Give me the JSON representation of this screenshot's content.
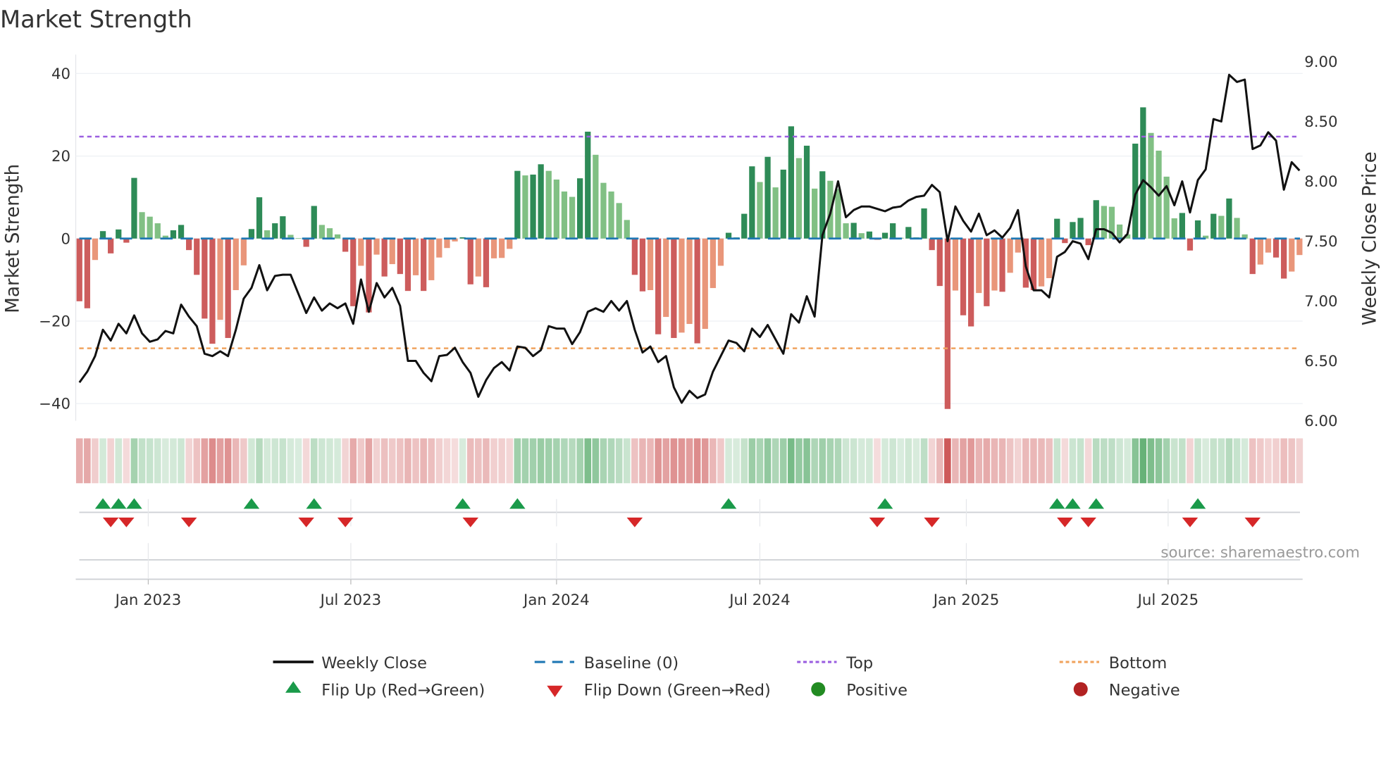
{
  "chart_data": {
    "type": "bar",
    "title": "Market Strength",
    "ylabel": "Market Strength",
    "y2label": "Weekly Close Price",
    "ylim": [
      -44,
      43
    ],
    "y2lim": [
      6.0,
      9.0
    ],
    "yticks": [
      "40",
      "20",
      "0",
      "−20",
      "−40"
    ],
    "ytick_values": [
      40,
      20,
      0,
      -20,
      -40
    ],
    "y2ticks": [
      "9.00",
      "8.50",
      "8.00",
      "7.50",
      "7.00",
      "6.50",
      "6.00"
    ],
    "y2tick_values": [
      9.0,
      8.5,
      8.0,
      7.5,
      7.0,
      6.5,
      6.0
    ],
    "xticks": [
      "Jan 2023",
      "Jul 2023",
      "Jan 2024",
      "Jul 2024",
      "Jan 2025",
      "Jul 2025"
    ],
    "xtick_week_index": [
      8.8,
      34.7,
      61,
      87,
      113.4,
      139.2
    ],
    "grid": true,
    "top_level": 24.7,
    "bottom_level": -26.6,
    "baseline": 0,
    "strength": [
      -15.2,
      -16.9,
      -5.2,
      1.8,
      -3.6,
      2.2,
      -1.0,
      14.7,
      6.4,
      5.3,
      3.7,
      0.7,
      2.0,
      3.3,
      -2.8,
      -8.8,
      -19.4,
      -25.5,
      -19.7,
      -24.1,
      -12.5,
      -6.5,
      2.3,
      10.0,
      2.0,
      3.7,
      5.4,
      0.9,
      0.1,
      -2.0,
      7.9,
      3.3,
      2.5,
      1.0,
      -3.2,
      -16.4,
      -6.6,
      -17.9,
      -3.9,
      -9.2,
      -6.2,
      -8.6,
      -12.7,
      -8.9,
      -12.7,
      -10.1,
      -4.6,
      -2.3,
      -0.7,
      0.3,
      -11.1,
      -9.2,
      -11.8,
      -4.8,
      -4.7,
      -2.5,
      16.4,
      15.3,
      15.5,
      18.0,
      16.4,
      14.3,
      11.4,
      10.1,
      14.6,
      25.9,
      20.3,
      13.5,
      11.4,
      8.6,
      4.5,
      -8.8,
      -12.8,
      -12.5,
      -23.2,
      -19.0,
      -24.1,
      -22.8,
      -20.7,
      -25.4,
      -21.9,
      -12.0,
      -6.6,
      1.4,
      0.3,
      6.0,
      17.5,
      13.7,
      19.8,
      12.4,
      16.7,
      27.2,
      19.5,
      22.5,
      12.1,
      16.3,
      14.0,
      12.0,
      3.7,
      3.8,
      1.3,
      1.7,
      -0.3,
      1.4,
      3.7,
      0.2,
      2.8,
      0.3,
      7.3,
      -2.8,
      -11.5,
      -41.3,
      -12.6,
      -18.6,
      -21.3,
      -13.2,
      -16.4,
      -12.6,
      -12.9,
      -8.3,
      -3.4,
      -11.9,
      -12.5,
      -11.6,
      -9.6,
      4.8,
      -1.1,
      4.0,
      5.0,
      -1.6,
      9.3,
      7.9,
      7.7,
      3.4,
      1.0,
      23.0,
      31.8,
      25.6,
      21.3,
      15.0,
      4.9,
      6.2,
      -2.9,
      4.4,
      0.7,
      6.0,
      5.5,
      9.7,
      5.0,
      1.0,
      -8.6,
      -6.3,
      -3.4,
      -4.6,
      -9.7,
      -8.0,
      -4.0
    ],
    "weekly_close": [
      6.32,
      6.41,
      6.54,
      6.76,
      6.67,
      6.81,
      6.73,
      6.88,
      6.73,
      6.66,
      6.68,
      6.75,
      6.73,
      6.97,
      6.87,
      6.79,
      6.56,
      6.54,
      6.58,
      6.54,
      6.76,
      7.02,
      7.11,
      7.3,
      7.09,
      7.21,
      7.22,
      7.22,
      7.06,
      6.9,
      7.03,
      6.92,
      6.98,
      6.94,
      6.98,
      6.81,
      7.18,
      6.91,
      7.15,
      7.03,
      7.11,
      6.96,
      6.5,
      6.5,
      6.4,
      6.33,
      6.54,
      6.55,
      6.61,
      6.49,
      6.4,
      6.2,
      6.34,
      6.44,
      6.49,
      6.42,
      6.62,
      6.61,
      6.54,
      6.59,
      6.79,
      6.77,
      6.77,
      6.64,
      6.74,
      6.91,
      6.94,
      6.91,
      7.0,
      6.92,
      7.0,
      6.76,
      6.57,
      6.62,
      6.49,
      6.54,
      6.28,
      6.15,
      6.25,
      6.19,
      6.22,
      6.41,
      6.54,
      6.67,
      6.65,
      6.58,
      6.77,
      6.7,
      6.8,
      6.68,
      6.56,
      6.89,
      6.82,
      7.04,
      6.87,
      7.55,
      7.73,
      8.0,
      7.7,
      7.76,
      7.79,
      7.79,
      7.77,
      7.75,
      7.78,
      7.79,
      7.84,
      7.87,
      7.88,
      7.97,
      7.91,
      7.5,
      7.79,
      7.67,
      7.58,
      7.73,
      7.55,
      7.59,
      7.53,
      7.61,
      7.76,
      7.29,
      7.09,
      7.09,
      7.03,
      7.37,
      7.41,
      7.5,
      7.48,
      7.35,
      7.6,
      7.6,
      7.57,
      7.49,
      7.56,
      7.89,
      8.01,
      7.95,
      7.88,
      7.96,
      7.8,
      8.0,
      7.74,
      8.01,
      8.1,
      8.52,
      8.5,
      8.89,
      8.83,
      8.85,
      8.27,
      8.3,
      8.41,
      8.34,
      7.93,
      8.16,
      8.09
    ],
    "legend": {
      "placement": "bottom",
      "weekly_close": "Weekly Close",
      "baseline": "Baseline (0)",
      "top": "Top",
      "bottom": "Bottom",
      "flip_up": "Flip Up (Red→Green)",
      "flip_down": "Flip Down (Green→Red)",
      "positive": "Positive",
      "negative": "Negative"
    },
    "source": "source: sharemaestro.com",
    "colors": {
      "pos_strong": "#2e8b57",
      "pos_weak": "#81c084",
      "neg_strong": "#cd5c5c",
      "neg_weak": "#e9967a",
      "baseline": "#1f77b4",
      "top": "#9b5fe0",
      "bottom": "#f0a35e",
      "flip_up": "#1a9a4a",
      "flip_down": "#d62728",
      "positive": "#228b22",
      "negative": "#b22222",
      "price": "#111111"
    }
  }
}
